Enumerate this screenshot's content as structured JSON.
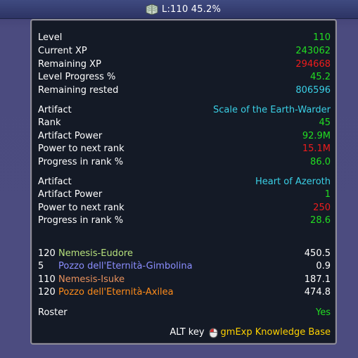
{
  "topbar": {
    "icon": "book-icon",
    "label": "L:110 45.2%"
  },
  "colors": {
    "green": "#22dd22",
    "red": "#ee1c1c",
    "cyan": "#3ad0e6",
    "white": "#ffffff",
    "yellow": "#ffd200",
    "char_color_1": "#b6e07c",
    "char_color_2": "#8b8eff",
    "char_color_3": "#e8915c",
    "char_color_4": "#ff8c1a"
  },
  "xp": {
    "level_label": "Level",
    "level_value": "110",
    "current_xp_label": "Current XP",
    "current_xp_value": "243062",
    "remaining_xp_label": "Remaining XP",
    "remaining_xp_value": "294668",
    "level_progress_label": "Level Progress %",
    "level_progress_value": "45.2",
    "remaining_rested_label": "Remaining rested",
    "remaining_rested_value": "806596"
  },
  "artifact1": {
    "artifact_label": "Artifact",
    "artifact_value": "Scale of the Earth-Warder",
    "rank_label": "Rank",
    "rank_value": "45",
    "power_label": "Artifact Power",
    "power_value": "92.9M",
    "next_rank_label": "Power to next rank",
    "next_rank_value": "15.1M",
    "progress_label": "Progress in rank %",
    "progress_value": "86.0"
  },
  "artifact2": {
    "artifact_label": "Artifact",
    "artifact_value": "Heart of Azeroth",
    "power_label": "Artifact Power",
    "power_value": "1",
    "next_rank_label": "Power to next rank",
    "next_rank_value": "250",
    "progress_label": "Progress in rank %",
    "progress_value": "28.6"
  },
  "characters": [
    {
      "level": "120",
      "name": "Nemesis-Eudore",
      "value": "450.5"
    },
    {
      "level": "5",
      "name": "Pozzo dell'Eternità-Gimbolina",
      "value": "0.9"
    },
    {
      "level": "110",
      "name": "Nemesis-Isuke",
      "value": "187.1"
    },
    {
      "level": "120",
      "name": "Pozzo dell'Eternità-Axilea",
      "value": "474.8"
    }
  ],
  "roster": {
    "label": "Roster",
    "value": "Yes"
  },
  "footer": {
    "alt_key_label": "ALT key",
    "mouse_icon": "mouse-icon",
    "knowledge_base_label": "gmExp Knowledge Base"
  }
}
